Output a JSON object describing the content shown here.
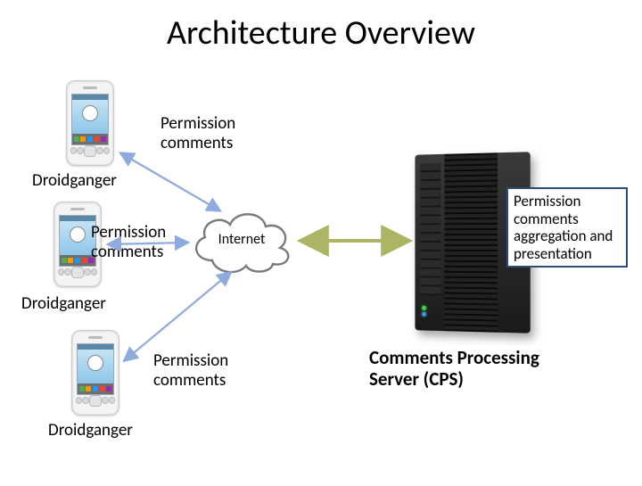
{
  "title": "Architecture Overview",
  "phones": {
    "phone1_label": "Droidganger",
    "phone2_label": "Droidganger",
    "phone3_label": "Droidganger",
    "perm1": "Permission\ncomments",
    "perm2": "Permission\ncomments",
    "perm3": "Permission\ncomments"
  },
  "cloud": {
    "label": "Internet"
  },
  "server": {
    "caption": "Permission comments aggregation and presentation",
    "name": "Comments Processing Server (CPS)"
  },
  "colors": {
    "arrow_blue": "#8faadc",
    "arrow_olive": "#adb565",
    "caption_border": "#2a4d7a",
    "icon_green": "#4caf50",
    "icon_orange": "#ff9800",
    "icon_blue": "#2196f3",
    "icon_red": "#f44336",
    "icon_purple": "#9c27b0",
    "led_green": "#3bdc3b",
    "led_blue": "#3b9bdc"
  }
}
